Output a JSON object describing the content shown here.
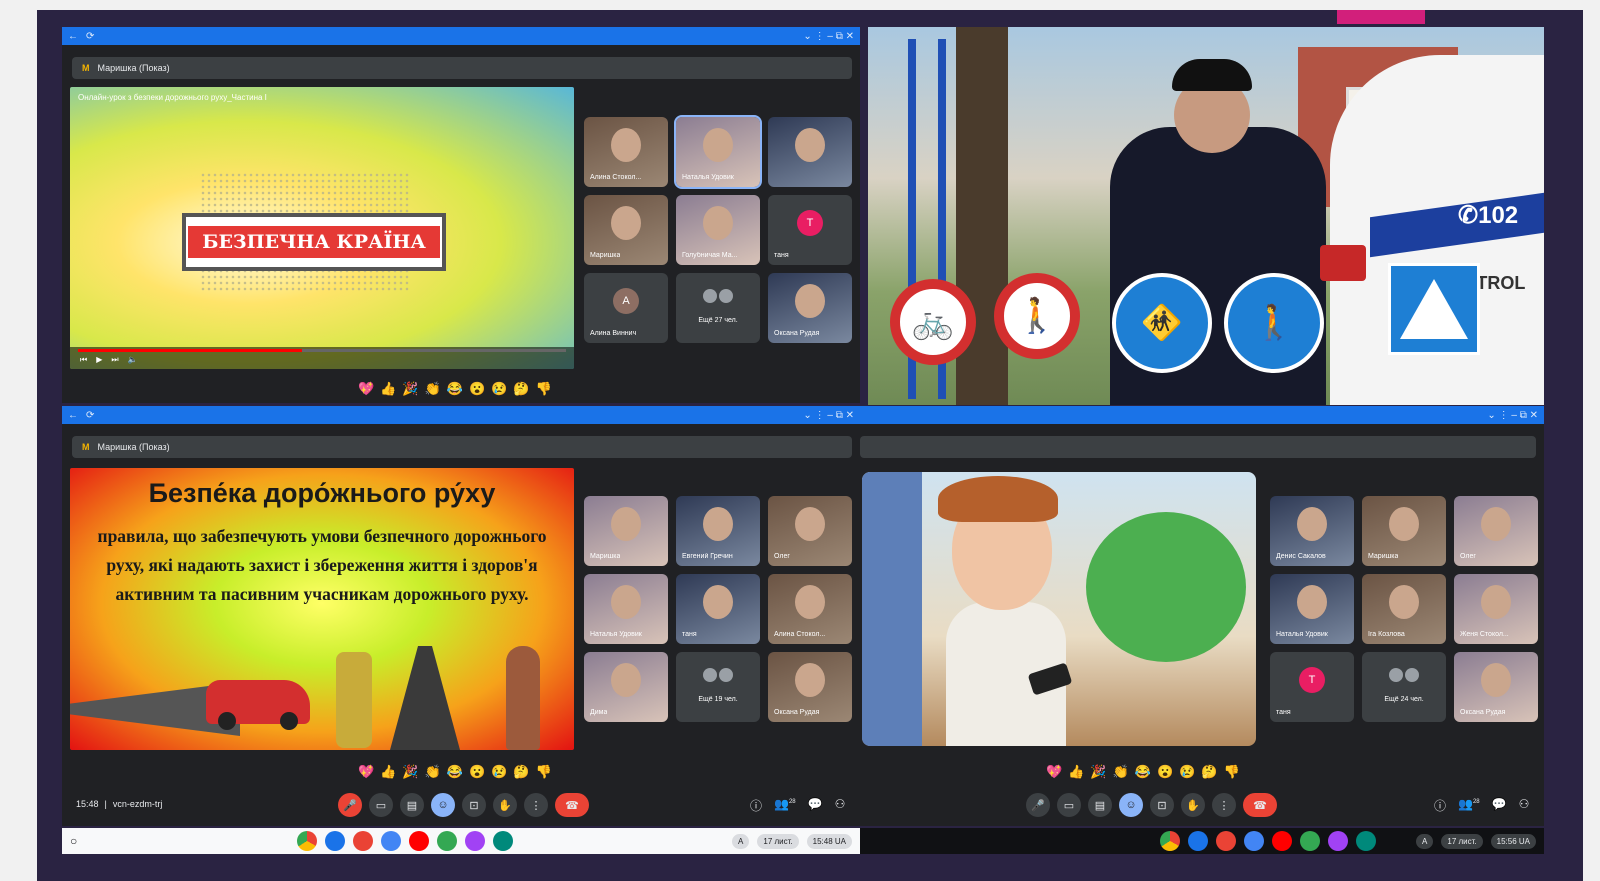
{
  "colors": {
    "chrome_blue": "#1a73e8",
    "meet_dark": "#202124",
    "tile_bg": "#3c4043",
    "leave_red": "#ea4335",
    "frame": "#2a2342",
    "accent_pink": "#d21f7b"
  },
  "reactions": [
    "💖",
    "👍",
    "🎉",
    "👏",
    "😂",
    "😮",
    "😢",
    "🤔",
    "👎"
  ],
  "q1": {
    "window_controls": "⌄ ⋮ – ⧉ ✕",
    "presenter": "Маришка (Показ)",
    "video": {
      "title": "Онлайн-урок з безпеки дорожнього руху_Частина І",
      "banner": "БЕЗПЕЧНА КРАЇНА",
      "progress": 0.46
    },
    "tiles": [
      {
        "name": "Алина Стокол..."
      },
      {
        "name": "Наталья Удовик"
      },
      {
        "name": ""
      },
      {
        "name": "Маришка"
      },
      {
        "name": "Голубничая Ма..."
      },
      {
        "name": "таня",
        "avatar": "Т",
        "avatar_color": "#e91e63"
      },
      {
        "name": "Алина Виннич",
        "avatar": "А",
        "avatar_color": "#8d6e63"
      },
      {
        "name": "Ещё 27 чел."
      },
      {
        "name": "Оксана Рудая"
      }
    ]
  },
  "q2": {
    "car_text": {
      "phone": "102",
      "patrol": "PATROL"
    },
    "signs": [
      "bicycle-prohibited-sign",
      "pedestrian-prohibited-sign",
      "bike-and-pedestrian-path-sign",
      "pedestrian-path-sign",
      "crosswalk-sign"
    ]
  },
  "q3": {
    "window_controls": "⌄ ⋮ – ⧉ ✕",
    "presenter": "Маришка (Показ)",
    "slide": {
      "title": "Безпе́ка доро́жнього ру́ху",
      "body": "правила, що забезпечують умови безпечного дорожнього руху, які надають захист і збереження життя і здоров'я активним та пасивним учасникам дорожнього руху."
    },
    "tiles": [
      {
        "name": "Маришка"
      },
      {
        "name": "Евгений Гречин"
      },
      {
        "name": "Олег"
      },
      {
        "name": "Наталья Удовик"
      },
      {
        "name": "таня"
      },
      {
        "name": "Алина Стокол..."
      },
      {
        "name": "Дима"
      },
      {
        "name": "Ещё 19 чел."
      },
      {
        "name": "Оксана Рудая"
      }
    ],
    "meeting_time": "15:48",
    "meeting_code": "vcn-ezdm-trj",
    "participants_badge": "28",
    "shelf": {
      "launcher": "○",
      "clock": "15:48 UA",
      "date": "17 лист.",
      "lang": "A"
    }
  },
  "q4": {
    "window_controls": "⌄ ⋮ – ⧉ ✕",
    "tiles": [
      {
        "name": "Денис Сакалов"
      },
      {
        "name": "Маришка"
      },
      {
        "name": "Олег"
      },
      {
        "name": "Наталья Удовик"
      },
      {
        "name": "Ira Козлова"
      },
      {
        "name": "Женя Стокол..."
      },
      {
        "name": "таня",
        "avatar": "Т",
        "avatar_color": "#e91e63"
      },
      {
        "name": "Ещё 24 чел."
      },
      {
        "name": "Оксана Рудая"
      }
    ],
    "participants_badge": "28",
    "shelf": {
      "clock": "15:56 UA",
      "date": "17 лист.",
      "lang": "A"
    }
  }
}
